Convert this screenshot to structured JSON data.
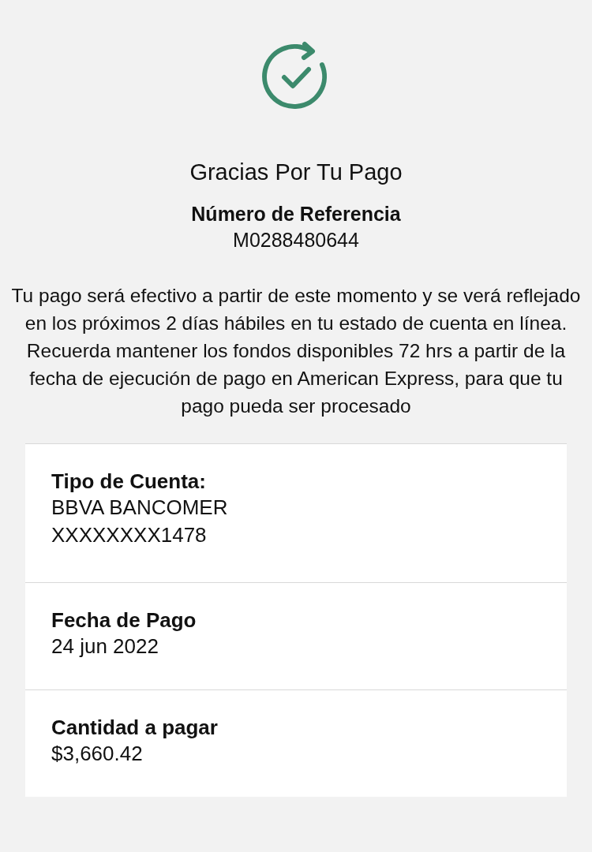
{
  "title": "Gracias Por Tu Pago",
  "reference": {
    "label": "Número de Referencia",
    "value": "M0288480644"
  },
  "message": "Tu pago será efectivo a partir de este momento y se verá reflejado en los próximos 2 días hábiles en tu estado de cuenta en línea. Recuerda mantener los fondos disponibles 72 hrs a partir de la fecha de ejecución de pago en American Express, para que tu pago pueda ser procesado",
  "details": [
    {
      "label": "Tipo de Cuenta:",
      "values": [
        "BBVA BANCOMER",
        "XXXXXXXX1478"
      ]
    },
    {
      "label": "Fecha de Pago",
      "values": [
        "24 jun 2022"
      ]
    },
    {
      "label": "Cantidad a pagar",
      "values": [
        "$3,660.42"
      ]
    }
  ]
}
